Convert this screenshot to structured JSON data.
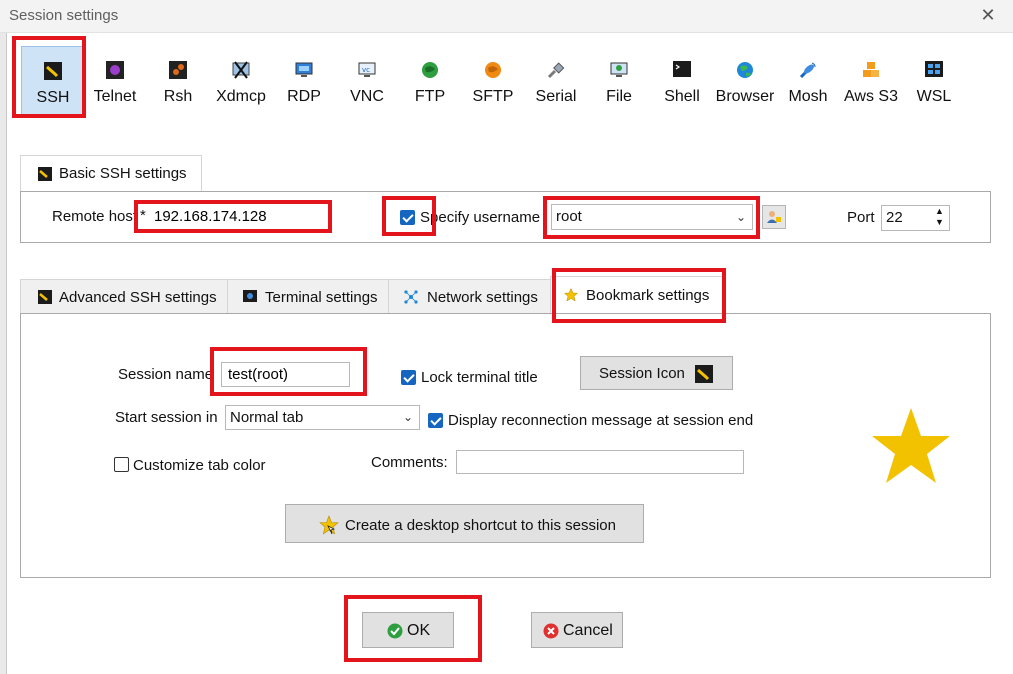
{
  "window": {
    "title": "Session settings",
    "close_symbol": "✕"
  },
  "protocols": [
    {
      "label": "SSH",
      "icon": "ssh-key-icon",
      "active": true
    },
    {
      "label": "Telnet",
      "icon": "telnet-icon"
    },
    {
      "label": "Rsh",
      "icon": "rsh-icon"
    },
    {
      "label": "Xdmcp",
      "icon": "xdmcp-icon"
    },
    {
      "label": "RDP",
      "icon": "rdp-monitor-icon"
    },
    {
      "label": "VNC",
      "icon": "vnc-icon"
    },
    {
      "label": "FTP",
      "icon": "ftp-globe-icon"
    },
    {
      "label": "SFTP",
      "icon": "sftp-globe-icon"
    },
    {
      "label": "Serial",
      "icon": "serial-plug-icon"
    },
    {
      "label": "File",
      "icon": "file-monitor-icon"
    },
    {
      "label": "Shell",
      "icon": "shell-terminal-icon"
    },
    {
      "label": "Browser",
      "icon": "browser-globe-icon"
    },
    {
      "label": "Mosh",
      "icon": "mosh-satellite-icon"
    },
    {
      "label": "Aws S3",
      "icon": "aws-s3-cubes-icon"
    },
    {
      "label": "WSL",
      "icon": "wsl-windows-icon"
    }
  ],
  "basic": {
    "tab_label": "Basic SSH settings",
    "remote_host_label": "Remote host",
    "required_mark": "*",
    "remote_host_value": "192.168.174.128",
    "specify_username_label": "Specify username",
    "specify_username_checked": true,
    "username_value": "root",
    "port_label": "Port",
    "port_value": "22"
  },
  "tabs": [
    {
      "label": "Advanced SSH settings",
      "icon": "ssh-key-icon"
    },
    {
      "label": "Terminal settings",
      "icon": "terminal-icon"
    },
    {
      "label": "Network settings",
      "icon": "network-icon"
    },
    {
      "label": "Bookmark settings",
      "icon": "star-icon",
      "selected": true
    }
  ],
  "bookmark": {
    "session_name_label": "Session name",
    "session_name_value": "test(root)",
    "lock_terminal_title_label": "Lock terminal title",
    "lock_terminal_title_checked": true,
    "session_icon_label": "Session Icon",
    "start_session_in_label": "Start session in",
    "start_session_in_value": "Normal tab",
    "display_reconnection_label": "Display reconnection message at session end",
    "display_reconnection_checked": true,
    "customize_tab_color_label": "Customize tab color",
    "customize_tab_color_checked": false,
    "comments_label": "Comments:",
    "comments_value": "",
    "shortcut_label": "Create a desktop shortcut to this session"
  },
  "footer": {
    "ok_label": "OK",
    "cancel_label": "Cancel"
  },
  "colors": {
    "highlight_red": "#e3141b",
    "accent_blue": "#1466c0",
    "star_gold": "#f2c200",
    "ok_green": "#2e9e3f",
    "cancel_red": "#e03030"
  }
}
